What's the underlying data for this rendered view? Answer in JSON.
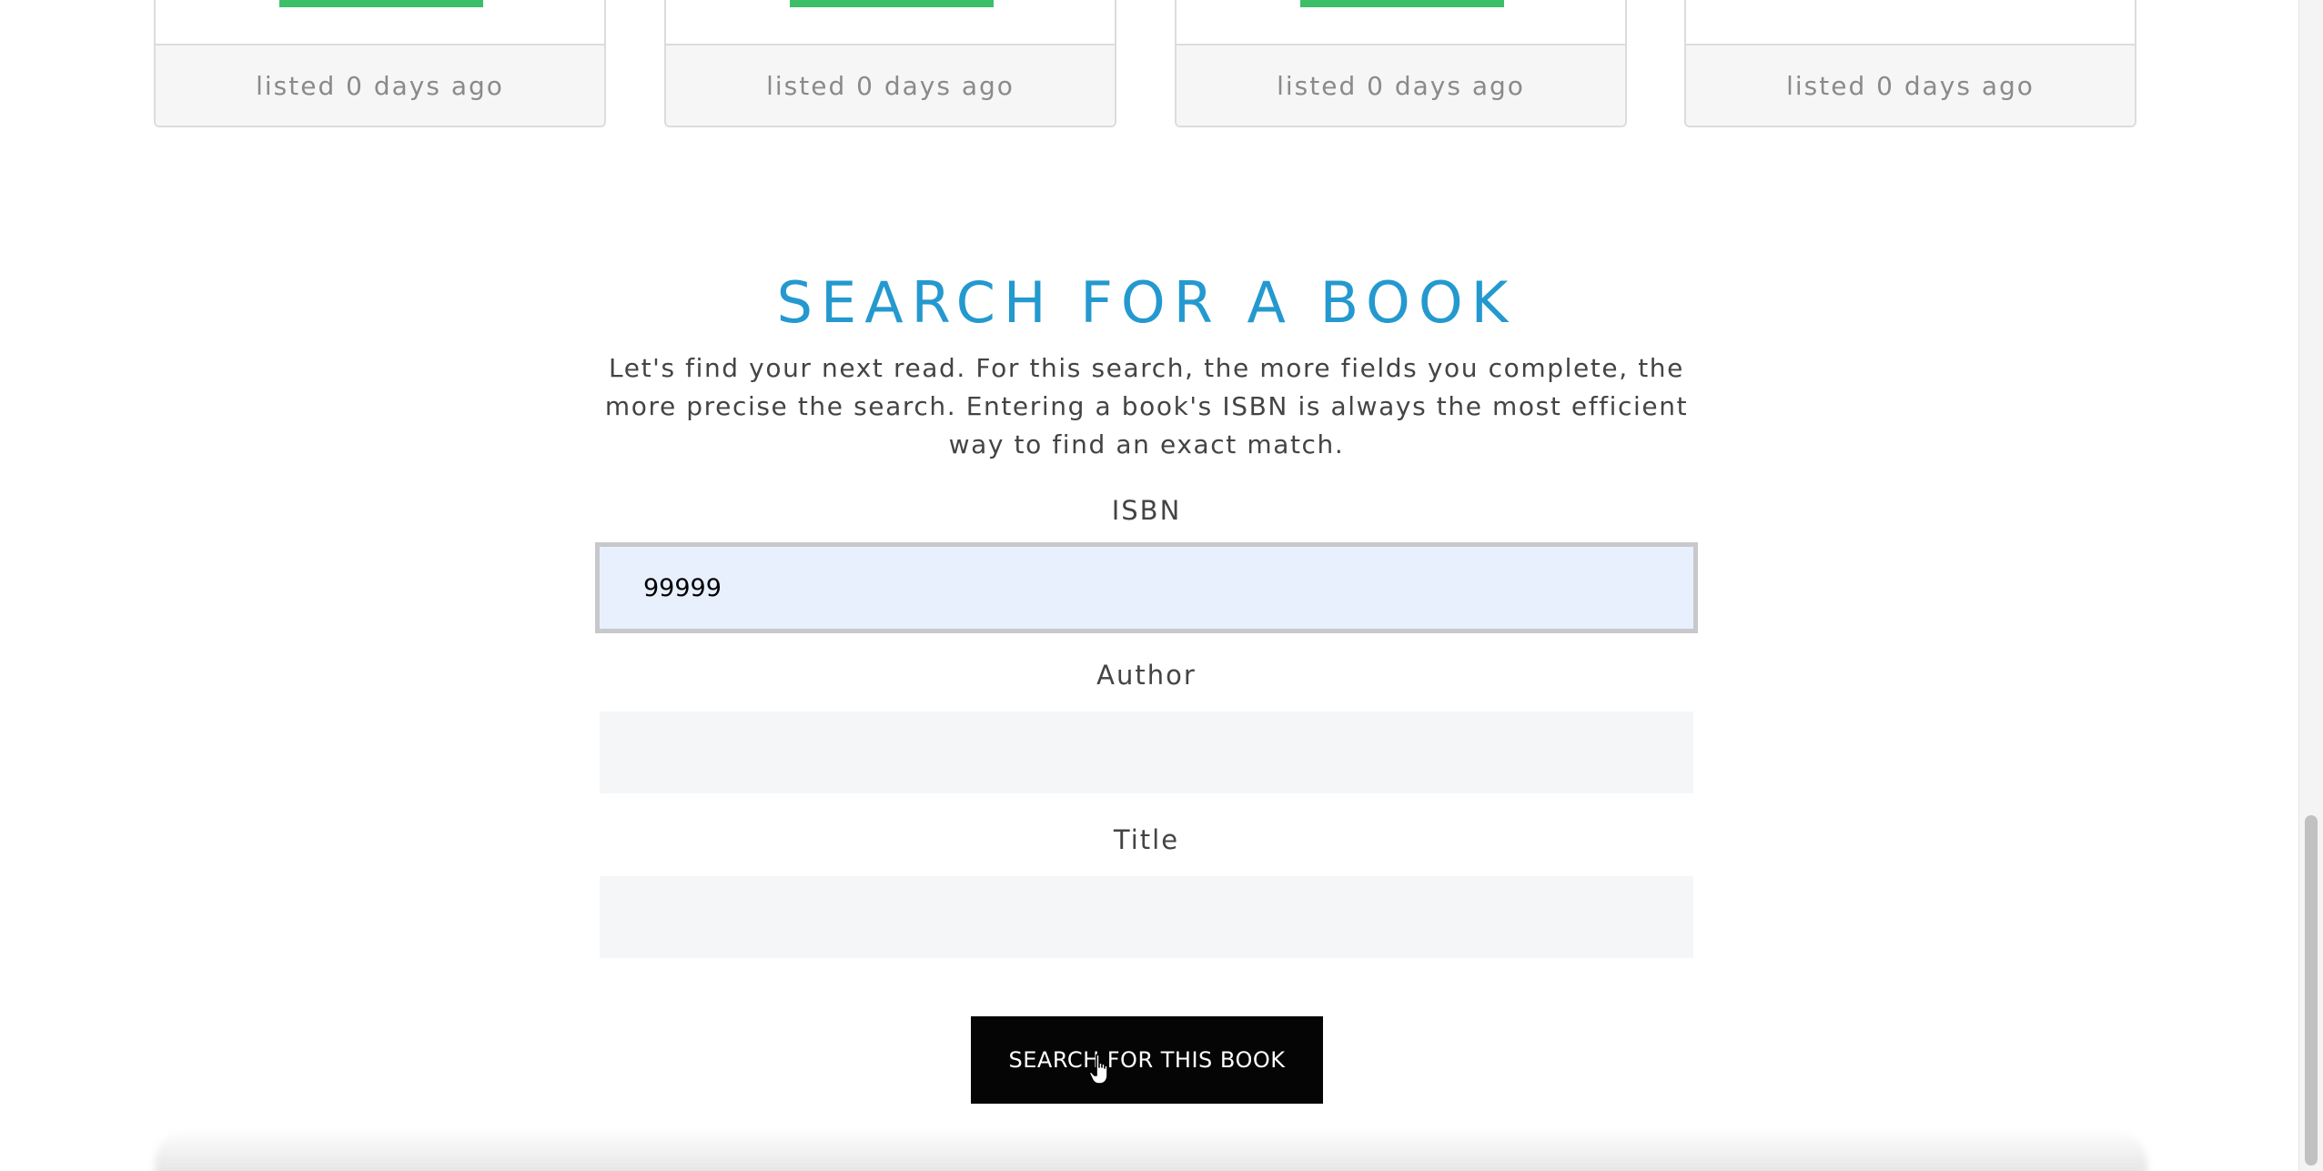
{
  "listings": {
    "cards": [
      {
        "footer": "listed 0 days ago"
      },
      {
        "footer": "listed 0 days ago"
      },
      {
        "footer": "listed 0 days ago"
      },
      {
        "footer": "listed 0 days ago"
      }
    ]
  },
  "search": {
    "title": "SEARCH FOR A BOOK",
    "description": "Let's find your next read. For this search, the more fields you complete, the more precise the search. Entering a book's ISBN is always the most efficient way to find an exact match.",
    "isbn": {
      "label": "ISBN",
      "value": "99999"
    },
    "author": {
      "label": "Author",
      "value": ""
    },
    "title_field": {
      "label": "Title",
      "value": ""
    },
    "submit_label": "SEARCH FOR THIS BOOK"
  },
  "colors": {
    "accent": "#2499cf",
    "status_bar": "#3dbf6a",
    "button": "#050505",
    "focused_input": "#e8f0fe"
  },
  "icons": {
    "cursor": "hand-pointer-icon"
  }
}
